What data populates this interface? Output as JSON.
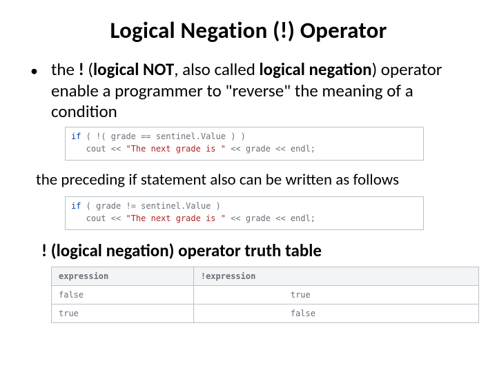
{
  "title": "Logical Negation (!) Operator",
  "bullet": {
    "prefix": "the ",
    "bang": "!",
    "lparen": " (",
    "not": "logical NOT",
    "comma": ", ",
    "also": "also called ",
    "negation": "logical negation",
    "after": ") operator enable a programmer to \"reverse\" the meaning of a condition"
  },
  "code1": {
    "if_kw": "if",
    "cond": " ( !( grade == sentinel.Value ) )",
    "out": "   cout << ",
    "str": "\"The next grade is \"",
    "tail": " << grade << endl;"
  },
  "midtext": "the preceding if statement also can be written as follows",
  "code2": {
    "if_kw": "if",
    "cond": " ( grade != sentinel.Value )",
    "out": "   cout << ",
    "str": "\"The next grade is \"",
    "tail": " << grade << endl;"
  },
  "subhead": "! (logical negation) operator truth table",
  "table": {
    "h1": "expression",
    "h2": "!expression",
    "rows": [
      {
        "a": "false",
        "b": "true"
      },
      {
        "a": "true",
        "b": "false"
      }
    ]
  }
}
